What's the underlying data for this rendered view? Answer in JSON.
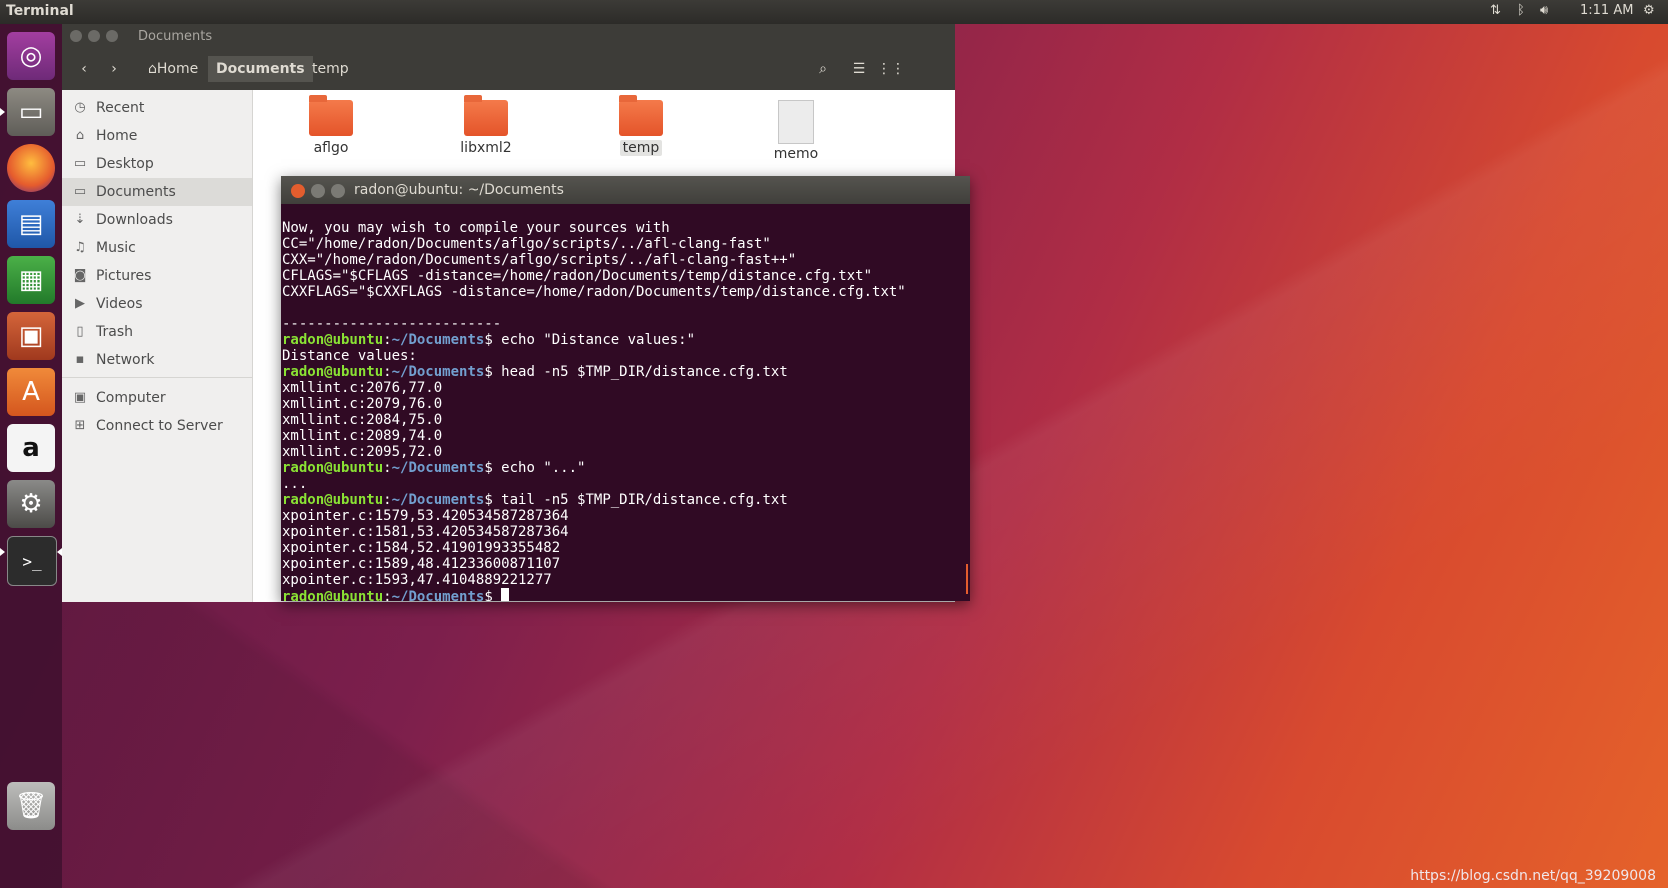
{
  "topbar": {
    "app_name": "Terminal",
    "time": "1:11 AM"
  },
  "launcher": {
    "items": [
      {
        "name": "dash"
      },
      {
        "name": "files"
      },
      {
        "name": "firefox"
      },
      {
        "name": "writer"
      },
      {
        "name": "calc"
      },
      {
        "name": "impress"
      },
      {
        "name": "software-center"
      },
      {
        "name": "amazon"
      },
      {
        "name": "settings"
      },
      {
        "name": "terminal"
      },
      {
        "name": "trash"
      }
    ]
  },
  "files": {
    "window_title": "Documents",
    "breadcrumb": {
      "home": "Home",
      "documents": "Documents",
      "temp": "temp"
    },
    "sidebar": [
      {
        "label": "Recent",
        "icon": "clock-icon"
      },
      {
        "label": "Home",
        "icon": "home-icon"
      },
      {
        "label": "Desktop",
        "icon": "folder-icon"
      },
      {
        "label": "Documents",
        "icon": "folder-icon"
      },
      {
        "label": "Downloads",
        "icon": "download-icon"
      },
      {
        "label": "Music",
        "icon": "music-icon"
      },
      {
        "label": "Pictures",
        "icon": "camera-icon"
      },
      {
        "label": "Videos",
        "icon": "video-icon"
      },
      {
        "label": "Trash",
        "icon": "trash-icon"
      },
      {
        "label": "Network",
        "icon": "network-icon"
      },
      {
        "label": "Computer",
        "icon": "computer-icon"
      },
      {
        "label": "Connect to Server",
        "icon": "server-icon"
      }
    ],
    "items": [
      {
        "label": "aflgo",
        "type": "folder"
      },
      {
        "label": "libxml2",
        "type": "folder"
      },
      {
        "label": "temp",
        "type": "folder"
      },
      {
        "label": "memo",
        "type": "document"
      }
    ]
  },
  "terminal": {
    "title": "radon@ubuntu: ~/Documents",
    "prompt_user": "radon@ubuntu",
    "prompt_dir": "~/Documents",
    "lines": {
      "l0": "Now, you may wish to compile your sources with",
      "l1": "CC=\"/home/radon/Documents/aflgo/scripts/../afl-clang-fast\"",
      "l2": "CXX=\"/home/radon/Documents/aflgo/scripts/../afl-clang-fast++\"",
      "l3": "CFLAGS=\"$CFLAGS -distance=/home/radon/Documents/temp/distance.cfg.txt\"",
      "l4": "CXXFLAGS=\"$CXXFLAGS -distance=/home/radon/Documents/temp/distance.cfg.txt\"",
      "l6": "--------------------------",
      "c1": " echo \"Distance values:\"",
      "l8": "Distance values:",
      "c2": " head -n5 $TMP_DIR/distance.cfg.txt",
      "l10": "xmllint.c:2076,77.0",
      "l11": "xmllint.c:2079,76.0",
      "l12": "xmllint.c:2084,75.0",
      "l13": "xmllint.c:2089,74.0",
      "l14": "xmllint.c:2095,72.0",
      "c3": " echo \"...\"",
      "l16": "...",
      "c4": " tail -n5 $TMP_DIR/distance.cfg.txt",
      "l18": "xpointer.c:1579,53.420534587287364",
      "l19": "xpointer.c:1581,53.420534587287364",
      "l20": "xpointer.c:1584,52.41901993355482",
      "l21": "xpointer.c:1589,48.41233600871107",
      "l22": "xpointer.c:1593,47.4104889221277"
    }
  },
  "watermark": "https://blog.csdn.net/qq_39209008"
}
